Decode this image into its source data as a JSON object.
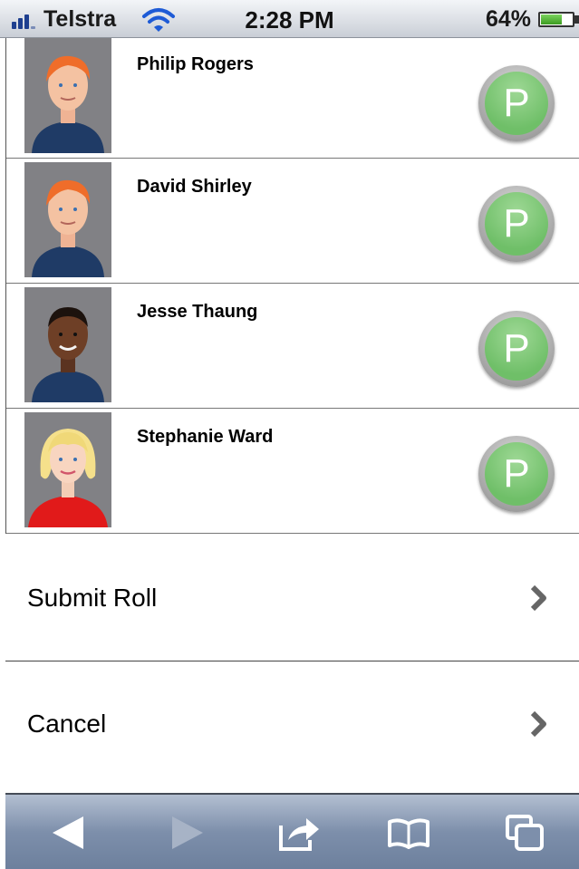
{
  "status_bar": {
    "carrier": "Telstra",
    "time": "2:28 PM",
    "battery": "64%",
    "battery_level": 0.64
  },
  "students": [
    {
      "name": "Philip Rogers",
      "status": "P",
      "avatar": "male-orange-hair-avatar"
    },
    {
      "name": "David Shirley",
      "status": "P",
      "avatar": "male-orange-hair-avatar"
    },
    {
      "name": "Jesse Thaung",
      "status": "P",
      "avatar": "male-dark-skin-avatar"
    },
    {
      "name": "Stephanie Ward",
      "status": "P",
      "avatar": "female-blonde-avatar"
    }
  ],
  "actions": {
    "submit": "Submit Roll",
    "cancel": "Cancel"
  },
  "toolbar": {
    "icons": [
      "back-arrow-icon",
      "forward-arrow-icon",
      "share-icon",
      "bookmarks-icon",
      "pages-icon"
    ]
  },
  "colors": {
    "present_green": "#6fbf68",
    "toolbar_blue": "#7d8fab",
    "signal_blue": "#1e3f8f"
  }
}
